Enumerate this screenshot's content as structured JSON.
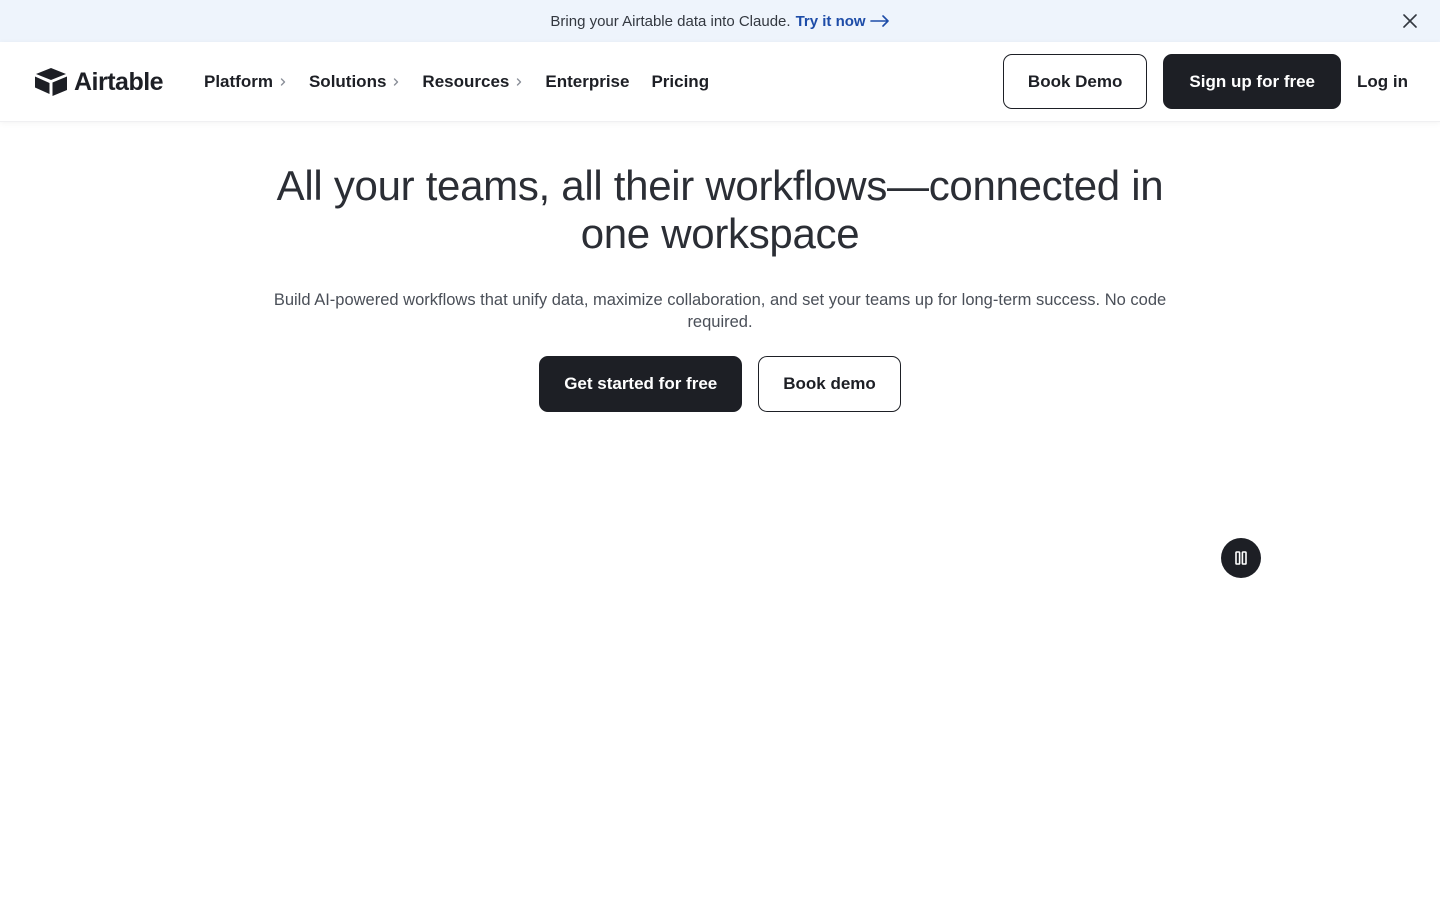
{
  "banner": {
    "message": "Bring your Airtable data into Claude.",
    "link_label": "Try it now",
    "close_icon": "close-icon"
  },
  "nav": {
    "logo_text": "Airtable",
    "menu": [
      {
        "label": "Platform",
        "has_submenu": true
      },
      {
        "label": "Solutions",
        "has_submenu": true
      },
      {
        "label": "Resources",
        "has_submenu": true
      },
      {
        "label": "Enterprise",
        "has_submenu": false
      },
      {
        "label": "Pricing",
        "has_submenu": false
      }
    ],
    "book_demo_label": "Book Demo",
    "signup_label": "Sign up for free",
    "login_label": "Log in"
  },
  "hero": {
    "title": "All your teams, all their workflows—connected in one workspace",
    "subtitle": "Build AI-powered workflows that unify data, maximize collaboration, and set your teams up for long-term success. No code required.",
    "primary_cta": "Get started for free",
    "secondary_cta": "Book demo"
  },
  "media_controls": {
    "pause_icon": "pause-icon"
  },
  "colors": {
    "banner_bg": "#eef4fc",
    "link": "#1d4ca8",
    "dark": "#1d1f25"
  }
}
